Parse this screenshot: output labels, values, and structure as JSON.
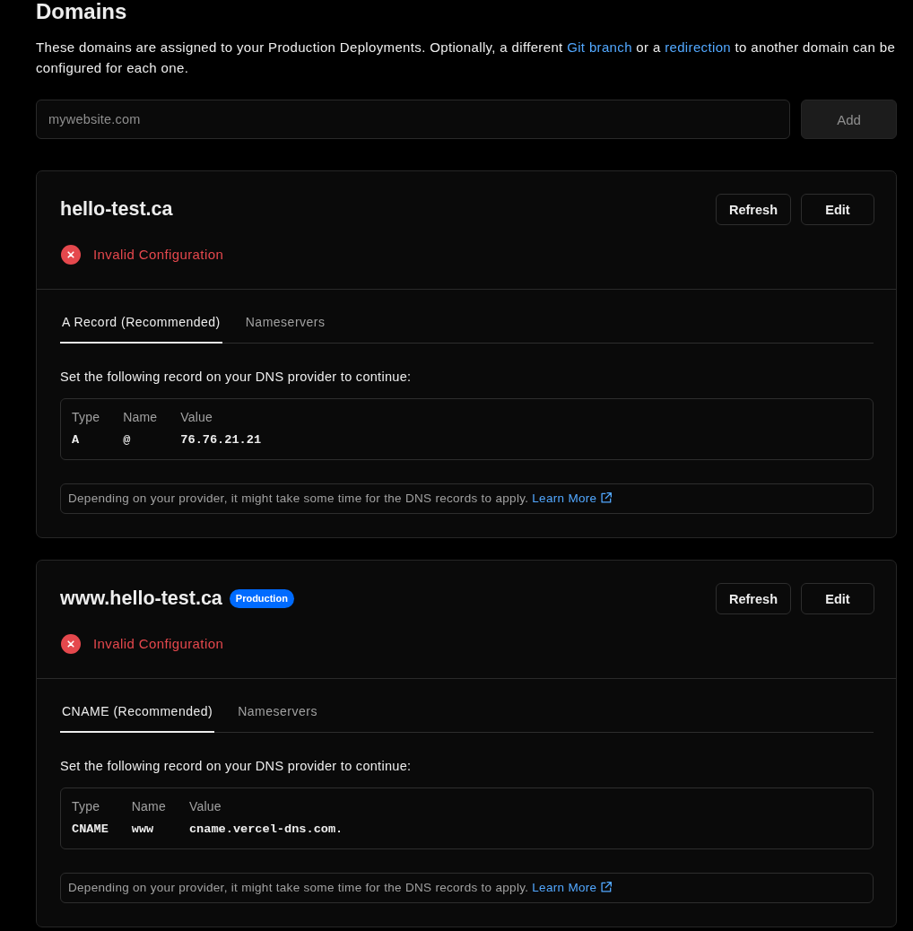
{
  "heading": "Domains",
  "description": [
    {
      "kind": "text",
      "text": "These domains are assigned to your Production Deployments. Optionally, a different "
    },
    {
      "kind": "link",
      "text": "Git branch"
    },
    {
      "kind": "text",
      "text": " or a "
    },
    {
      "kind": "link",
      "text": "redirection"
    },
    {
      "kind": "text",
      "text": " to another domain can be configured for each one."
    }
  ],
  "add_domain": {
    "placeholder": "mywebsite.com",
    "button": {
      "label": "Add",
      "disabled": true
    }
  },
  "domains": [
    {
      "name": "hello-test.ca",
      "buttons": [
        "Refresh",
        "Edit"
      ],
      "status": {
        "kind": "error",
        "text": "Invalid Configuration"
      },
      "tabs": [
        {
          "label": "A Record (Recommended)",
          "selected": true
        },
        {
          "label": "Nameservers",
          "selected": false
        }
      ],
      "instruction": "Set the following record on your DNS provider to continue:",
      "record": {
        "columns": [
          "Type",
          "Name",
          "Value"
        ],
        "rows": [
          [
            "A",
            "@",
            "76.76.21.21"
          ]
        ]
      },
      "note": {
        "text": "Depending on your provider, it might take some time for the DNS records to apply.",
        "link": "Learn More"
      }
    },
    {
      "name": "www.hello-test.ca",
      "badge": "Production",
      "buttons": [
        "Refresh",
        "Edit"
      ],
      "status": {
        "kind": "error",
        "text": "Invalid Configuration"
      },
      "tabs": [
        {
          "label": "CNAME (Recommended)",
          "selected": true
        },
        {
          "label": "Nameservers",
          "selected": false
        }
      ],
      "instruction": "Set the following record on your DNS provider to continue:",
      "record": {
        "columns": [
          "Type",
          "Name",
          "Value"
        ],
        "rows": [
          [
            "CNAME",
            "www",
            "cname.vercel-dns.com."
          ]
        ]
      },
      "note": {
        "text": "Depending on your provider, it might take some time for the DNS records to apply.",
        "link": "Learn More"
      }
    }
  ]
}
